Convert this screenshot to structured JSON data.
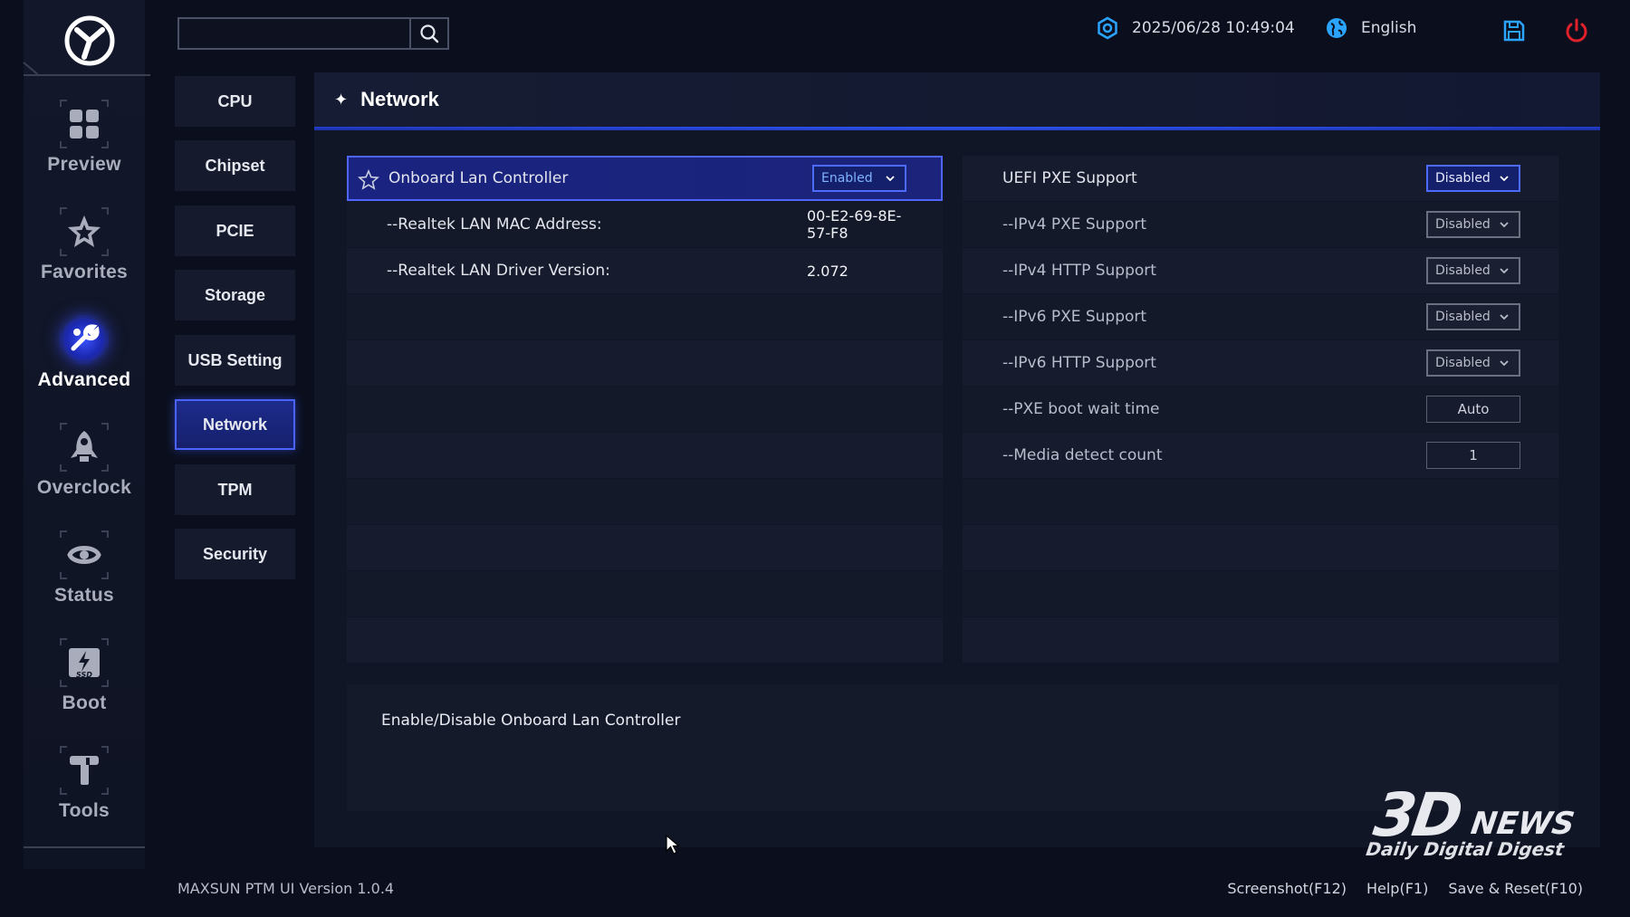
{
  "brand": {
    "logo_icon": "maxsun-logo"
  },
  "nav": {
    "items": [
      {
        "label": "Preview",
        "icon": "grid-icon"
      },
      {
        "label": "Favorites",
        "icon": "star-icon"
      },
      {
        "label": "Advanced",
        "icon": "wrench-icon",
        "active": true
      },
      {
        "label": "Overclock",
        "icon": "rocket-icon"
      },
      {
        "label": "Status",
        "icon": "gauge-icon"
      },
      {
        "label": "Boot",
        "icon": "ssd-icon"
      },
      {
        "label": "Tools",
        "icon": "tools-icon"
      }
    ]
  },
  "submenu": {
    "items": [
      "CPU",
      "Chipset",
      "PCIE",
      "Storage",
      "USB Setting",
      "Network",
      "TPM",
      "Security"
    ],
    "active": "Network"
  },
  "topbar": {
    "search_value": "",
    "datetime": "2025/06/28 10:49:04",
    "language": "English"
  },
  "main": {
    "title": "Network"
  },
  "left_rows": [
    {
      "label": "Onboard Lan Controller",
      "value": "Enabled"
    },
    {
      "label": "--Realtek LAN MAC Address:",
      "value_line1": "00-E2-69-8E-",
      "value_line2": "57-F8"
    },
    {
      "label": "--Realtek LAN Driver Version:",
      "value": "2.072"
    }
  ],
  "right_rows": [
    {
      "label": "UEFI PXE Support",
      "value": "Disabled"
    },
    {
      "label": "--IPv4 PXE Support",
      "value": "Disabled"
    },
    {
      "label": "--IPv4 HTTP Support",
      "value": "Disabled"
    },
    {
      "label": "--IPv6 PXE Support",
      "value": "Disabled"
    },
    {
      "label": "--IPv6 HTTP Support",
      "value": "Disabled"
    },
    {
      "label": "--PXE boot wait time",
      "value": "Auto"
    },
    {
      "label": "--Media detect count",
      "value": "1"
    }
  ],
  "help": {
    "text": "Enable/Disable Onboard Lan Controller"
  },
  "footer": {
    "version": "MAXSUN PTM UI Version 1.0.4",
    "links": [
      "Screenshot(F12)",
      "Help(F1)",
      "Save & Reset(F10)"
    ]
  },
  "watermark": {
    "line1": "3D",
    "line2": "NEWS",
    "line3": "Daily Digital Digest"
  },
  "colors": {
    "accent": "#4a63ff",
    "active_bg": "#1a2480",
    "power": "#e0202a",
    "info_blue": "#2aa4ff"
  }
}
